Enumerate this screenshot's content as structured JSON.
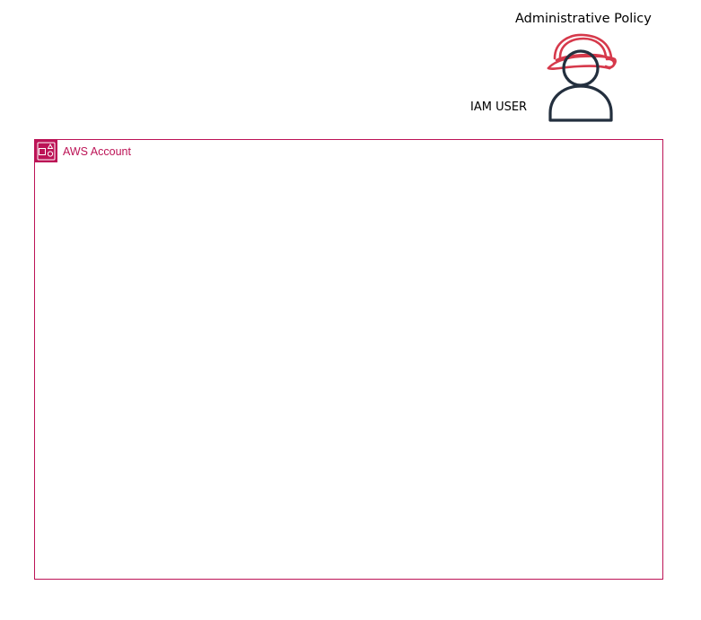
{
  "diagram": {
    "policy_label": "Administrative Policy",
    "user_label": "IAM USER",
    "account": {
      "title": "AWS Account",
      "icon": "aws-account-icon"
    },
    "user_icon": "iam-user-icon",
    "helmet_icon": "hard-hat-icon"
  },
  "colors": {
    "account_accent": "#BC1356",
    "helmet": "#D6394B",
    "user_outline": "#232F3E"
  }
}
